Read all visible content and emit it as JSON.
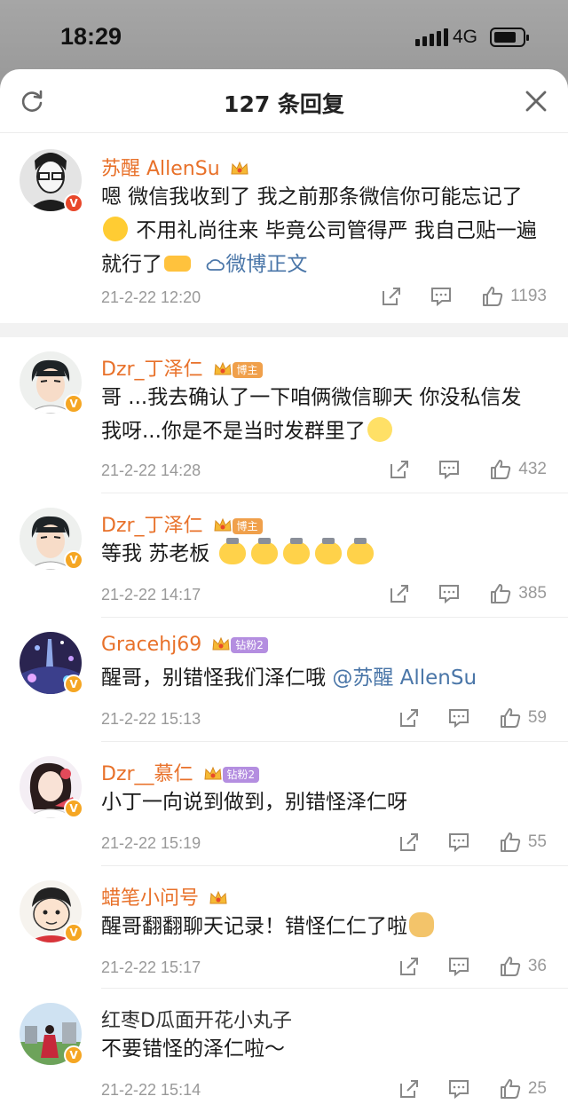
{
  "status_bar": {
    "time": "18:29",
    "network": "4G"
  },
  "header": {
    "title": "127 条回复"
  },
  "main_comment": {
    "author": "苏醒 AllenSu",
    "text_before_emoji": "嗯 微信我收到了 我之前那条微信你可能忘记了",
    "text_after_emoji": " 不用礼尚往来 毕竟公司管得严 我自己贴一遍就行了",
    "source_link": "微博正文",
    "date": "21-2-22 12:20",
    "likes": "1193"
  },
  "replies": [
    {
      "author": "Dzr_丁泽仁",
      "tag": "博主",
      "text": "哥 ...我去确认了一下咱俩微信聊天 你没私信发我呀...你是不是当时发群里了",
      "date": "21-2-22 14:28",
      "likes": "432"
    },
    {
      "author": "Dzr_丁泽仁",
      "tag": "博主",
      "text": "等我 苏老板",
      "date": "21-2-22 14:17",
      "likes": "385"
    },
    {
      "author": "Gracehj69",
      "tag": "钻粉2",
      "text": "醒哥，别错怪我们泽仁哦 ",
      "mention": "@苏醒 AllenSu",
      "date": "21-2-22 15:13",
      "likes": "59"
    },
    {
      "author": "Dzr__慕仁",
      "tag": "钻粉2",
      "text": "小丁一向说到做到，别错怪泽仁呀",
      "date": "21-2-22 15:19",
      "likes": "55"
    },
    {
      "author": "蜡笔小问号",
      "text": "醒哥翻翻聊天记录！错怪仁仁了啦",
      "date": "21-2-22 15:17",
      "likes": "36"
    },
    {
      "author": "红枣D瓜面开花小丸子",
      "text": "不要错怪的泽仁啦～",
      "date": "21-2-22 15:14",
      "likes": "25"
    }
  ],
  "colors": {
    "name_orange": "#e8712a",
    "link_blue": "#4a76a8",
    "meta_gray": "#999999"
  }
}
